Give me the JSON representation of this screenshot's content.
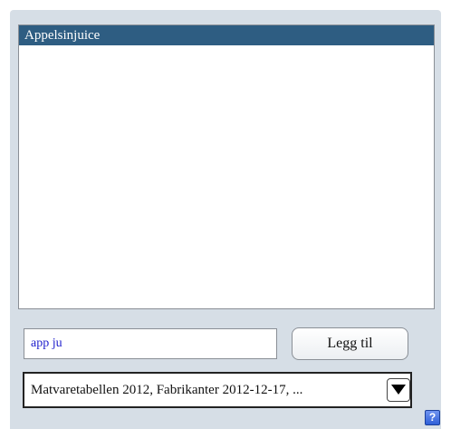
{
  "results_list": {
    "items": [
      {
        "label": "Appelsinjuice",
        "selected": true
      }
    ]
  },
  "search": {
    "value": "app ju"
  },
  "add_button": {
    "label": "Legg til"
  },
  "source_select": {
    "selected": "Matvaretabellen 2012, Fabrikanter 2012-12-17, ..."
  },
  "help_button": {
    "label": "?"
  },
  "colors": {
    "panel_background": "#d6dee6",
    "selection": "#2e5d82",
    "input_text": "#1d1dcc",
    "help_button": "#2f5fd8"
  }
}
